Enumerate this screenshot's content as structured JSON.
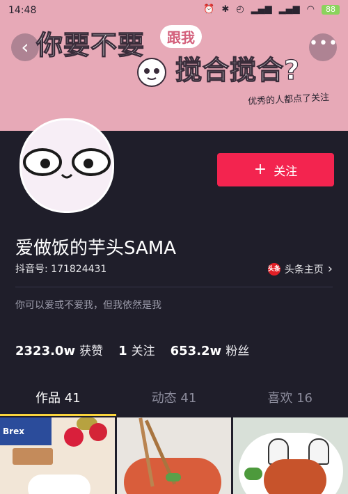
{
  "status_bar": {
    "time": "14:48",
    "icons": [
      "alarm-icon",
      "bluetooth-icon",
      "clock-icon",
      "signal-icon",
      "signal-icon",
      "wifi-icon"
    ],
    "battery": "88"
  },
  "banner": {
    "line1": "你要不要",
    "pill": "跟我",
    "line2": "搅合搅合?",
    "line3": "优秀的人都点了关注"
  },
  "nav": {
    "back_glyph": "‹",
    "more_glyph": "•••"
  },
  "profile": {
    "follow_label": "关注",
    "follow_plus": "+",
    "username": "爱做饭的芋头SAMA",
    "uid": "抖音号: 171824431",
    "homepage_label": "头条主页",
    "homepage_icon_text": "头条",
    "homepage_chevron": "›",
    "bio": "你可以爱或不爱我，但我依然是我"
  },
  "stats": [
    {
      "num": "2323.0w",
      "label": "获赞"
    },
    {
      "num": "1",
      "label": "关注"
    },
    {
      "num": "653.2w",
      "label": "粉丝"
    }
  ],
  "tabs": [
    {
      "label": "作品 41",
      "active": true
    },
    {
      "label": "动态 41",
      "active": false
    },
    {
      "label": "喜欢 16",
      "active": false
    }
  ],
  "thumbnails": {
    "t1_box_text": "Brex"
  },
  "colors": {
    "follow_button": "#f3244f",
    "tab_indicator": "#f9d43c",
    "background": "#1f1e2a"
  }
}
